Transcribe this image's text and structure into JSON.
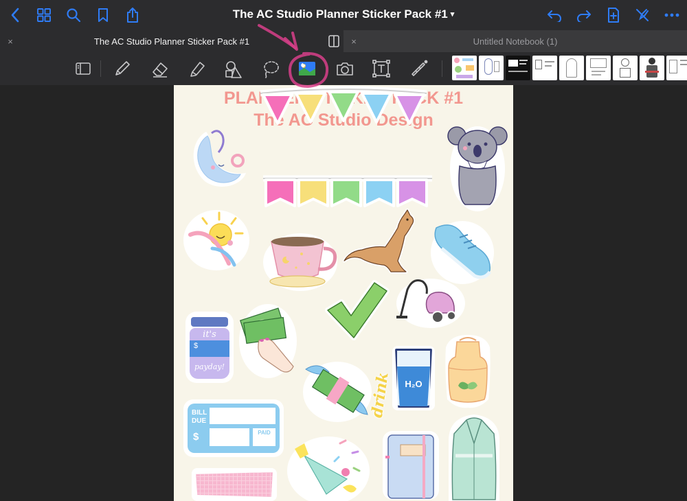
{
  "document": {
    "title": "The AC Studio Planner Sticker Pack #1"
  },
  "tabs": [
    {
      "label": "The AC Studio Planner Sticker Pack #1",
      "close": "×"
    },
    {
      "label": "Untitled Notebook (1)",
      "close": "×"
    }
  ],
  "page": {
    "heading": "PLANNER STICKER PACK #1",
    "subheading": "The AC Studio Design",
    "stickers": {
      "jar_text_1": "it's",
      "jar_text_2": "payday!",
      "bill_label_1": "BILL",
      "bill_label_2": "DUE",
      "bill_dollar": "$",
      "bill_paid": "PAID",
      "drink_word": "drink",
      "water_label": "H₂O",
      "jar_dollar": "$"
    }
  },
  "colors": {
    "accent": "#2f7cf6",
    "heading": "#f2978f",
    "annotation": "#d8408a"
  }
}
